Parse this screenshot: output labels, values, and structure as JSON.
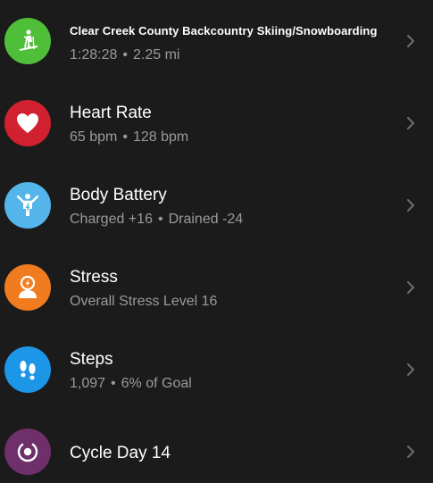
{
  "colors": {
    "background": "#1b1b1b",
    "title": "#ffffff",
    "subtitle": "#9a9a9a",
    "chevron": "#6e6e6e",
    "activity_icon": "#4fbf3a",
    "heart_icon": "#d1202f",
    "battery_icon": "#54b5ea",
    "stress_icon": "#f07c1f",
    "steps_icon": "#1c96e6",
    "cycle_icon": "#6e2f6b"
  },
  "items": [
    {
      "icon": "backcountry-ski-icon",
      "title": "Clear Creek County Backcountry Skiing/Snowboarding",
      "sub_a": "1:28:28",
      "sub_b": "2.25 mi"
    },
    {
      "icon": "heart-icon",
      "title": "Heart Rate",
      "sub_a": "65 bpm",
      "sub_b": "128 bpm"
    },
    {
      "icon": "body-battery-icon",
      "title": "Body Battery",
      "sub_a": "Charged +16",
      "sub_b": "Drained -24"
    },
    {
      "icon": "stress-icon",
      "title": "Stress",
      "sub_a": "Overall Stress Level 16"
    },
    {
      "icon": "footprints-icon",
      "title": "Steps",
      "sub_a": "1,097",
      "sub_b": "6% of Goal"
    },
    {
      "icon": "cycle-icon",
      "title": "Cycle Day 14"
    }
  ],
  "separator": "•"
}
